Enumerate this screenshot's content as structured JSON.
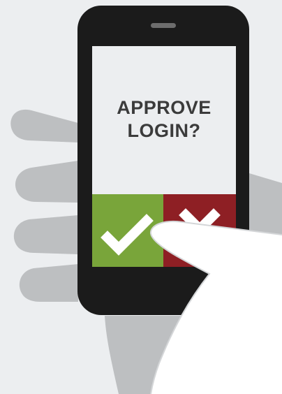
{
  "dialog": {
    "prompt_line1": "APPROVE",
    "prompt_line2": "LOGIN?"
  },
  "buttons": {
    "approve_icon": "checkmark-icon",
    "deny_icon": "x-icon"
  },
  "colors": {
    "background": "#eceef0",
    "phone_body": "#1b1b1b",
    "approve": "#79a53a",
    "deny": "#8e1f24",
    "hand": "#bdbfc1",
    "thumb": "#ffffff",
    "text": "#3b3b3b"
  }
}
